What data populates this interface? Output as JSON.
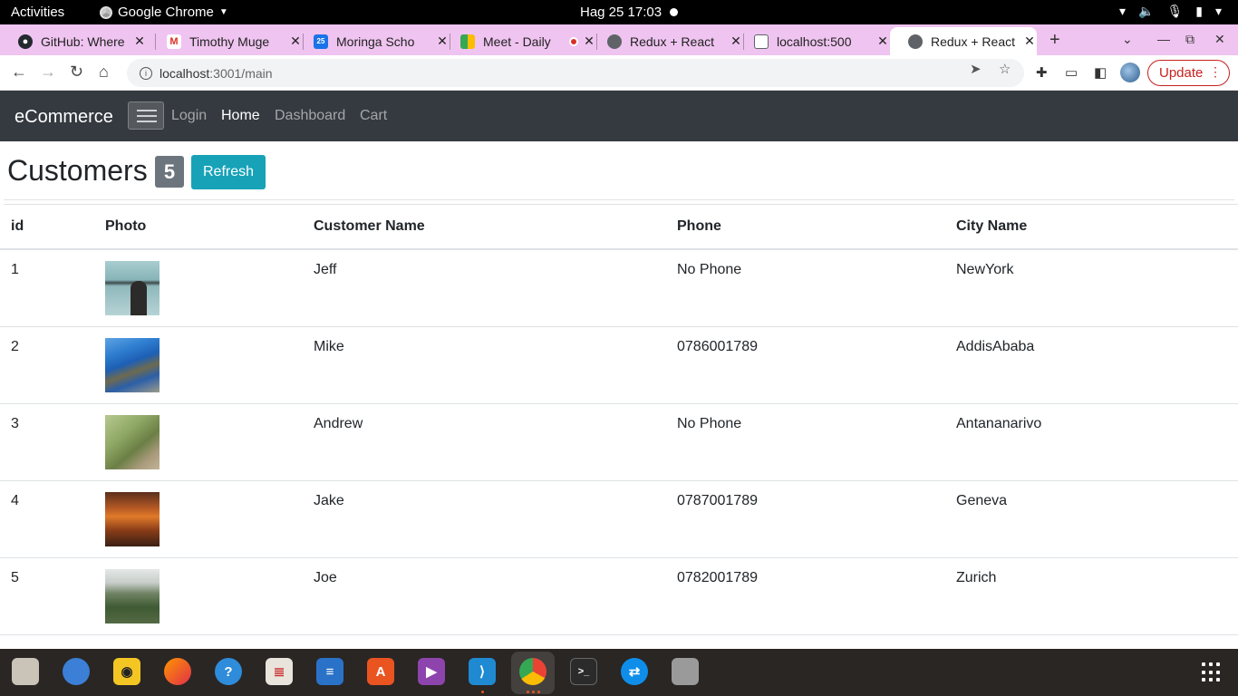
{
  "system_bar": {
    "activities": "Activities",
    "app_name": "Google Chrome",
    "clock": "Hag 25  17:03"
  },
  "browser": {
    "tabs": [
      {
        "title": "GitHub: Where",
        "icon": "github-icon",
        "active": false
      },
      {
        "title": "Timothy Muge",
        "icon": "gmail-icon",
        "active": false
      },
      {
        "title": "Moringa Scho",
        "icon": "calendar-icon",
        "active": false
      },
      {
        "title": "Meet - Daily",
        "icon": "meet-icon",
        "active": false
      },
      {
        "title": "Redux + React",
        "icon": "globe-icon",
        "active": false
      },
      {
        "title": "localhost:500",
        "icon": "local-icon",
        "active": false
      },
      {
        "title": "Redux + React",
        "icon": "globe-icon",
        "active": true
      }
    ],
    "url_host": "localhost",
    "url_path": ":3001/main",
    "update_label": "Update"
  },
  "navbar": {
    "brand": "eCommerce",
    "links": [
      "Login",
      "Home",
      "Dashboard",
      "Cart"
    ],
    "active_link": "Home"
  },
  "page": {
    "heading": "Customers",
    "count": "5",
    "refresh_label": "Refresh"
  },
  "table": {
    "columns": [
      "id",
      "Photo",
      "Customer Name",
      "Phone",
      "City Name"
    ],
    "rows": [
      {
        "id": "1",
        "name": "Jeff",
        "phone": "No Phone",
        "city": "NewYork"
      },
      {
        "id": "2",
        "name": "Mike",
        "phone": "0786001789",
        "city": "AddisAbaba"
      },
      {
        "id": "3",
        "name": "Andrew",
        "phone": "No Phone",
        "city": "Antananarivo"
      },
      {
        "id": "4",
        "name": "Jake",
        "phone": "0787001789",
        "city": "Geneva"
      },
      {
        "id": "5",
        "name": "Joe",
        "phone": "0782001789",
        "city": "Zurich"
      }
    ]
  },
  "colors": {
    "navbar": "#343a40",
    "tabstrip": "#efc4f0",
    "refresh_button": "#17a2b8",
    "badge": "#6c757d",
    "update": "#c5221f"
  }
}
